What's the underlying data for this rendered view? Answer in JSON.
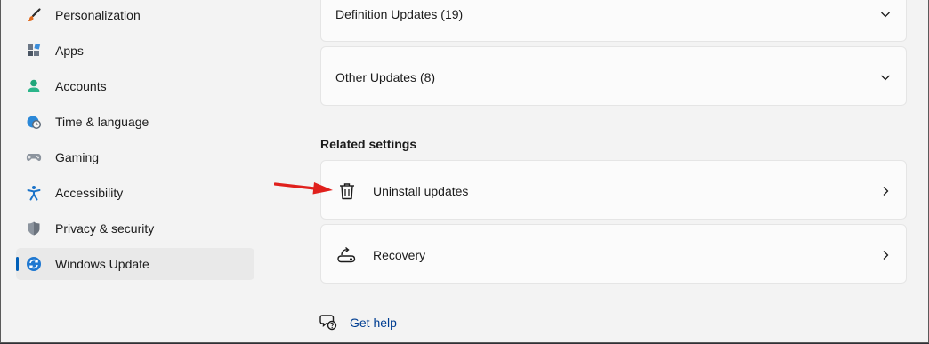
{
  "sidebar": {
    "items": [
      {
        "label": "Personalization",
        "icon": "brush-icon"
      },
      {
        "label": "Apps",
        "icon": "apps-icon"
      },
      {
        "label": "Accounts",
        "icon": "person-icon"
      },
      {
        "label": "Time & language",
        "icon": "globe-clock-icon"
      },
      {
        "label": "Gaming",
        "icon": "gamepad-icon"
      },
      {
        "label": "Accessibility",
        "icon": "accessibility-icon"
      },
      {
        "label": "Privacy & security",
        "icon": "shield-icon"
      },
      {
        "label": "Windows Update",
        "icon": "sync-icon",
        "active": true
      }
    ]
  },
  "updates": {
    "definition_label": "Definition Updates (19)",
    "other_label": "Other Updates (8)"
  },
  "related": {
    "title": "Related settings",
    "uninstall_label": "Uninstall updates",
    "recovery_label": "Recovery"
  },
  "help": {
    "label": "Get help"
  },
  "colors": {
    "accent": "#005fb8",
    "annotation_arrow": "#e0201c",
    "link": "#003e92"
  }
}
